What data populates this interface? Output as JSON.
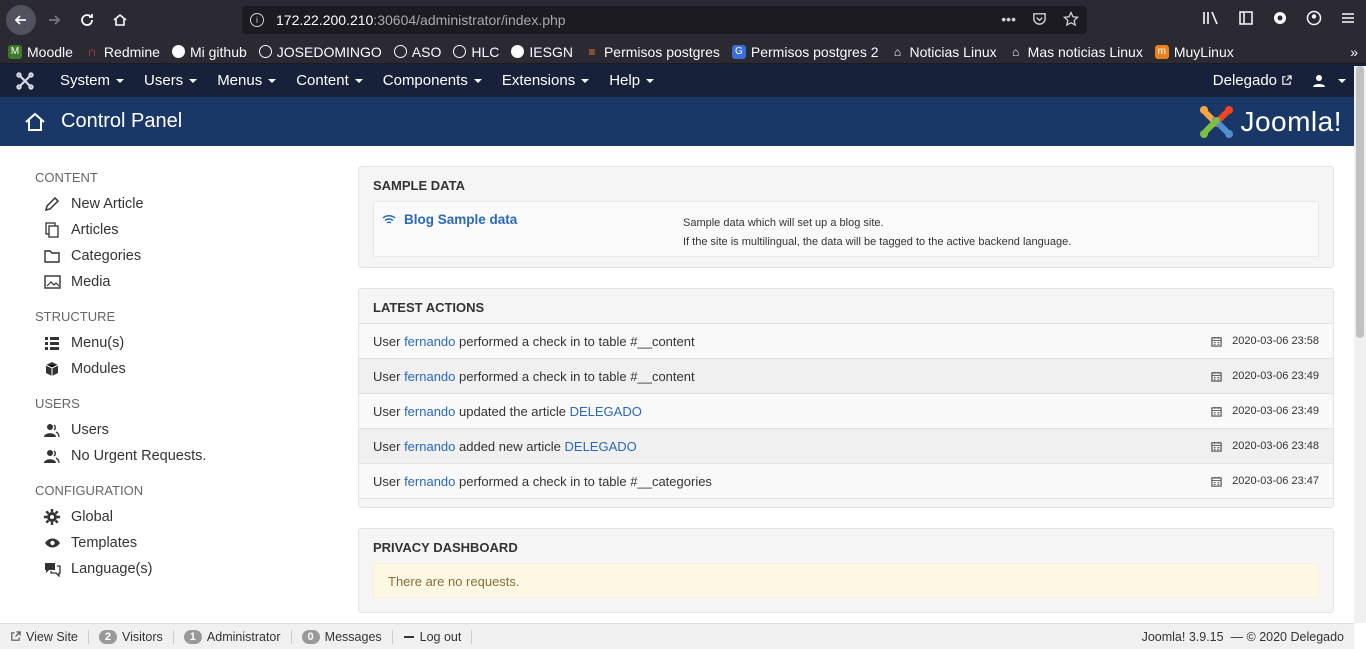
{
  "browser": {
    "url_host": "172.22.200.210",
    "url_path": ":30604/administrator/index.php",
    "bookmarks": [
      {
        "label": "Moodle",
        "icon": "moodle-icon"
      },
      {
        "label": "Redmine",
        "icon": "redmine-icon"
      },
      {
        "label": "Mi github",
        "icon": "github-icon"
      },
      {
        "label": "JOSEDOMINGO",
        "icon": "globe-icon"
      },
      {
        "label": "ASO",
        "icon": "globe-icon"
      },
      {
        "label": "HLC",
        "icon": "globe-icon"
      },
      {
        "label": "IESGN",
        "icon": "github-icon"
      },
      {
        "label": "Permisos postgres",
        "icon": "stackoverflow-icon"
      },
      {
        "label": "Permisos postgres 2",
        "icon": "google-icon"
      },
      {
        "label": "Noticias Linux",
        "icon": "linux-icon"
      },
      {
        "label": "Mas noticias Linux",
        "icon": "linux-icon"
      },
      {
        "label": "MuyLinux",
        "icon": "muylinux-icon"
      }
    ]
  },
  "topbar": {
    "menu": [
      "System",
      "Users",
      "Menus",
      "Content",
      "Components",
      "Extensions",
      "Help"
    ],
    "site_link": "Delegado"
  },
  "header": {
    "title": "Control Panel",
    "brand": "Joomla!"
  },
  "sidebar": {
    "sections": [
      {
        "title": "CONTENT",
        "items": [
          {
            "label": "New Article",
            "icon": "pencil-icon"
          },
          {
            "label": "Articles",
            "icon": "copy-icon"
          },
          {
            "label": "Categories",
            "icon": "folder-icon"
          },
          {
            "label": "Media",
            "icon": "image-icon"
          }
        ]
      },
      {
        "title": "STRUCTURE",
        "items": [
          {
            "label": "Menu(s)",
            "icon": "list-icon"
          },
          {
            "label": "Modules",
            "icon": "cube-icon"
          }
        ]
      },
      {
        "title": "USERS",
        "items": [
          {
            "label": "Users",
            "icon": "users-icon"
          },
          {
            "label": "No Urgent Requests.",
            "icon": "users-icon"
          }
        ]
      },
      {
        "title": "CONFIGURATION",
        "items": [
          {
            "label": "Global",
            "icon": "gear-icon"
          },
          {
            "label": "Templates",
            "icon": "eye-icon"
          },
          {
            "label": "Language(s)",
            "icon": "comments-icon"
          }
        ]
      }
    ]
  },
  "sample_data": {
    "title": "SAMPLE DATA",
    "link": "Blog Sample data",
    "desc_line1": "Sample data which will set up a blog site.",
    "desc_line2": "If the site is multilingual, the data will be tagged to the active backend language."
  },
  "latest_actions": {
    "title": "LATEST ACTIONS",
    "rows": [
      {
        "prefix": "User ",
        "user": "fernando",
        "action": " performed a check in to table #__content",
        "target": "",
        "date": "2020-03-06 23:58"
      },
      {
        "prefix": "User ",
        "user": "fernando",
        "action": " performed a check in to table #__content",
        "target": "",
        "date": "2020-03-06 23:49"
      },
      {
        "prefix": "User ",
        "user": "fernando",
        "action": " updated the article ",
        "target": "DELEGADO",
        "date": "2020-03-06 23:49"
      },
      {
        "prefix": "User ",
        "user": "fernando",
        "action": " added new article ",
        "target": "DELEGADO",
        "date": "2020-03-06 23:48"
      },
      {
        "prefix": "User ",
        "user": "fernando",
        "action": " performed a check in to table #__categories",
        "target": "",
        "date": "2020-03-06 23:47"
      }
    ]
  },
  "privacy": {
    "title": "PRIVACY DASHBOARD",
    "message": "There are no requests."
  },
  "statusbar": {
    "view_site": "View Site",
    "visitors_count": "2",
    "visitors_label": "Visitors",
    "admin_count": "1",
    "admin_label": "Administrator",
    "messages_count": "0",
    "messages_label": "Messages",
    "logout": "Log out",
    "version": "Joomla! 3.9.15",
    "copyright": "— © 2020 Delegado"
  }
}
